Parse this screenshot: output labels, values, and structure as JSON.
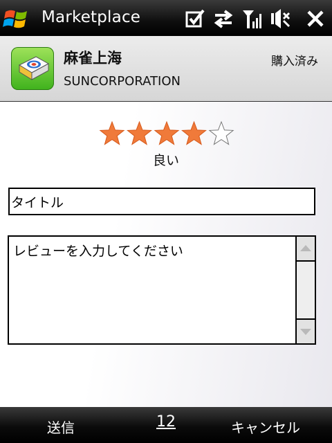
{
  "statusbar": {
    "title": "Marketplace",
    "icons": [
      "windows-start-icon",
      "checkbox-icon",
      "connectivity-arrows-icon",
      "signal-icon",
      "volume-muted-icon",
      "close-icon"
    ]
  },
  "app": {
    "name": "麻雀上海",
    "publisher": "SUNCORPORATION",
    "status": "購入済み",
    "icon": "mahjong-tile-icon"
  },
  "rating": {
    "value": 4,
    "max": 5,
    "label": "良い",
    "filled_color": "#f07a3a",
    "empty_color": "#ffffff"
  },
  "review": {
    "title_value": "タイトル",
    "body_placeholder": "レビューを入力してください"
  },
  "softkeys": {
    "left": "送信",
    "middle": "12",
    "right": "キャンセル"
  }
}
